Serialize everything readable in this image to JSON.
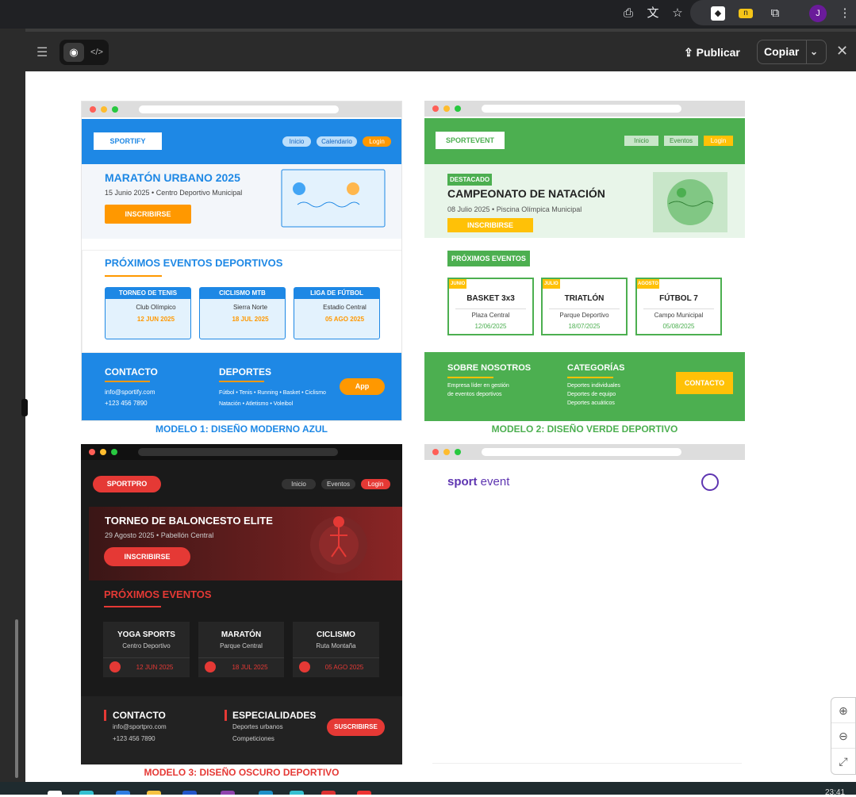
{
  "browser": {
    "avatar_letter": "J"
  },
  "toolbar": {
    "publish_label": "Publicar",
    "copy_label": "Copiar"
  },
  "bottom": {
    "clock": "23:41"
  },
  "m1": {
    "brand": "SPORTIFY",
    "nav": [
      "Inicio",
      "Calendario",
      "Login"
    ],
    "hero_title": "MARATÓN URBANO 2025",
    "hero_sub": "15 Junio 2025 • Centro Deportivo Municipal",
    "hero_btn": "INSCRIBIRSE",
    "section_title": "PRÓXIMOS EVENTOS DEPORTIVOS",
    "cards": [
      {
        "title": "TORNEO DE TENIS",
        "place": "Club Olímpico",
        "date": "12 JUN 2025"
      },
      {
        "title": "CICLISMO MTB",
        "place": "Sierra Norte",
        "date": "18 JUL 2025"
      },
      {
        "title": "LIGA DE FÚTBOL",
        "place": "Estadio Central",
        "date": "05 AGO 2025"
      }
    ],
    "contact_title": "CONTACTO",
    "email": "info@sportify.com",
    "phone": "+123 456 7890",
    "sports_title": "DEPORTES",
    "sports1": "Fútbol • Tenis • Running • Basket • Ciclismo",
    "sports2": "Natación • Atletismo • Voleibol",
    "app_btn": "App",
    "caption": "MODELO 1: DISEÑO MODERNO AZUL"
  },
  "m2": {
    "brand": "SPORTEVENT",
    "nav": [
      "Inicio",
      "Eventos",
      "Login"
    ],
    "badge": "DESTACADO",
    "hero_title": "CAMPEONATO DE NATACIÓN",
    "hero_sub": "08 Julio 2025 • Piscina Olímpica Municipal",
    "hero_btn": "INSCRIBIRSE",
    "section_title": "PRÓXIMOS EVENTOS",
    "cards": [
      {
        "month": "JUNIO",
        "title": "BASKET 3x3",
        "place": "Plaza Central",
        "date": "12/06/2025"
      },
      {
        "month": "JULIO",
        "title": "TRIATLÓN",
        "place": "Parque Deportivo",
        "date": "18/07/2025"
      },
      {
        "month": "AGOSTO",
        "title": "FÚTBOL 7",
        "place": "Campo Municipal",
        "date": "05/08/2025"
      }
    ],
    "about_title": "SOBRE NOSOTROS",
    "about1": "Empresa líder en gestión",
    "about2": "de eventos deportivos",
    "cat_title": "CATEGORÍAS",
    "cats": [
      "Deportes individuales",
      "Deportes de equipo",
      "Deportes acuáticos"
    ],
    "contact_btn": "CONTACTO",
    "caption": "MODELO 2: DISEÑO VERDE DEPORTIVO"
  },
  "m3": {
    "brand": "SPORTPRO",
    "nav": [
      "Inicio",
      "Eventos",
      "Login"
    ],
    "hero_title": "TORNEO DE BALONCESTO ELITE",
    "hero_sub": "29 Agosto 2025 • Pabellón Central",
    "hero_btn": "INSCRIBIRSE",
    "section_title": "PRÓXIMOS EVENTOS",
    "cards": [
      {
        "title": "YOGA SPORTS",
        "place": "Centro Deportivo",
        "date": "12 JUN 2025"
      },
      {
        "title": "MARATÓN",
        "place": "Parque Central",
        "date": "18 JUL 2025"
      },
      {
        "title": "CICLISMO",
        "place": "Ruta Montaña",
        "date": "05 AGO 2025"
      }
    ],
    "contact_title": "CONTACTO",
    "email": "info@sportpro.com",
    "phone": "+123 456 7890",
    "spec_title": "ESPECIALIDADES",
    "spec1": "Deportes urbanos",
    "spec2": "Competiciones",
    "sub_btn": "SUSCRIBIRSE",
    "caption": "MODELO 3: DISEÑO OSCURO DEPORTIVO"
  },
  "m4": {
    "logo_a": "sport",
    "logo_b": "event"
  },
  "colors": {
    "blue": "#1e88e5",
    "orange": "#ff9800",
    "green": "#4caf50",
    "yellow": "#ffc107",
    "red": "#e53935",
    "dark": "#1a1a1a",
    "purple": "#5e35b1"
  }
}
